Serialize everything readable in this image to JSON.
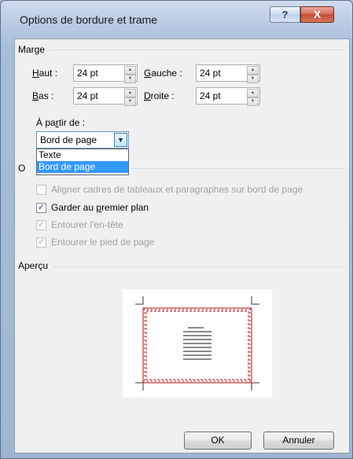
{
  "dialog": {
    "title": "Options de bordure et trame",
    "help_label": "?",
    "close_label": "X"
  },
  "margin": {
    "group_label": "Marge",
    "top_label": "aut :",
    "top_key": "H",
    "top_value": "24 pt",
    "left_label": "auche :",
    "left_key": "G",
    "left_value": "24 pt",
    "bottom_label": "as :",
    "bottom_key": "B",
    "bottom_value": "24 pt",
    "right_label": "roite :",
    "right_key": "D",
    "right_value": "24 pt",
    "from_label_a": "À pa",
    "from_key": "r",
    "from_label_b": "tir de :",
    "from_value": "Bord de page",
    "from_options": [
      "Texte",
      "Bord de page"
    ]
  },
  "options": {
    "group_label_visible": "O",
    "align_label": "Aligner cadres de tableaux et paragraphes sur bord de page",
    "front_label_a": "Garder au ",
    "front_key": "p",
    "front_label_b": "remier plan",
    "header_label": "Entourer l'en-tête",
    "footer_label": "Entourer le pied de page"
  },
  "preview": {
    "group_label": "Aperçu"
  },
  "buttons": {
    "ok": "OK",
    "cancel": "Annuler"
  },
  "colors": {
    "border_stitch": "#c03a3a",
    "selection": "#3399ff"
  }
}
